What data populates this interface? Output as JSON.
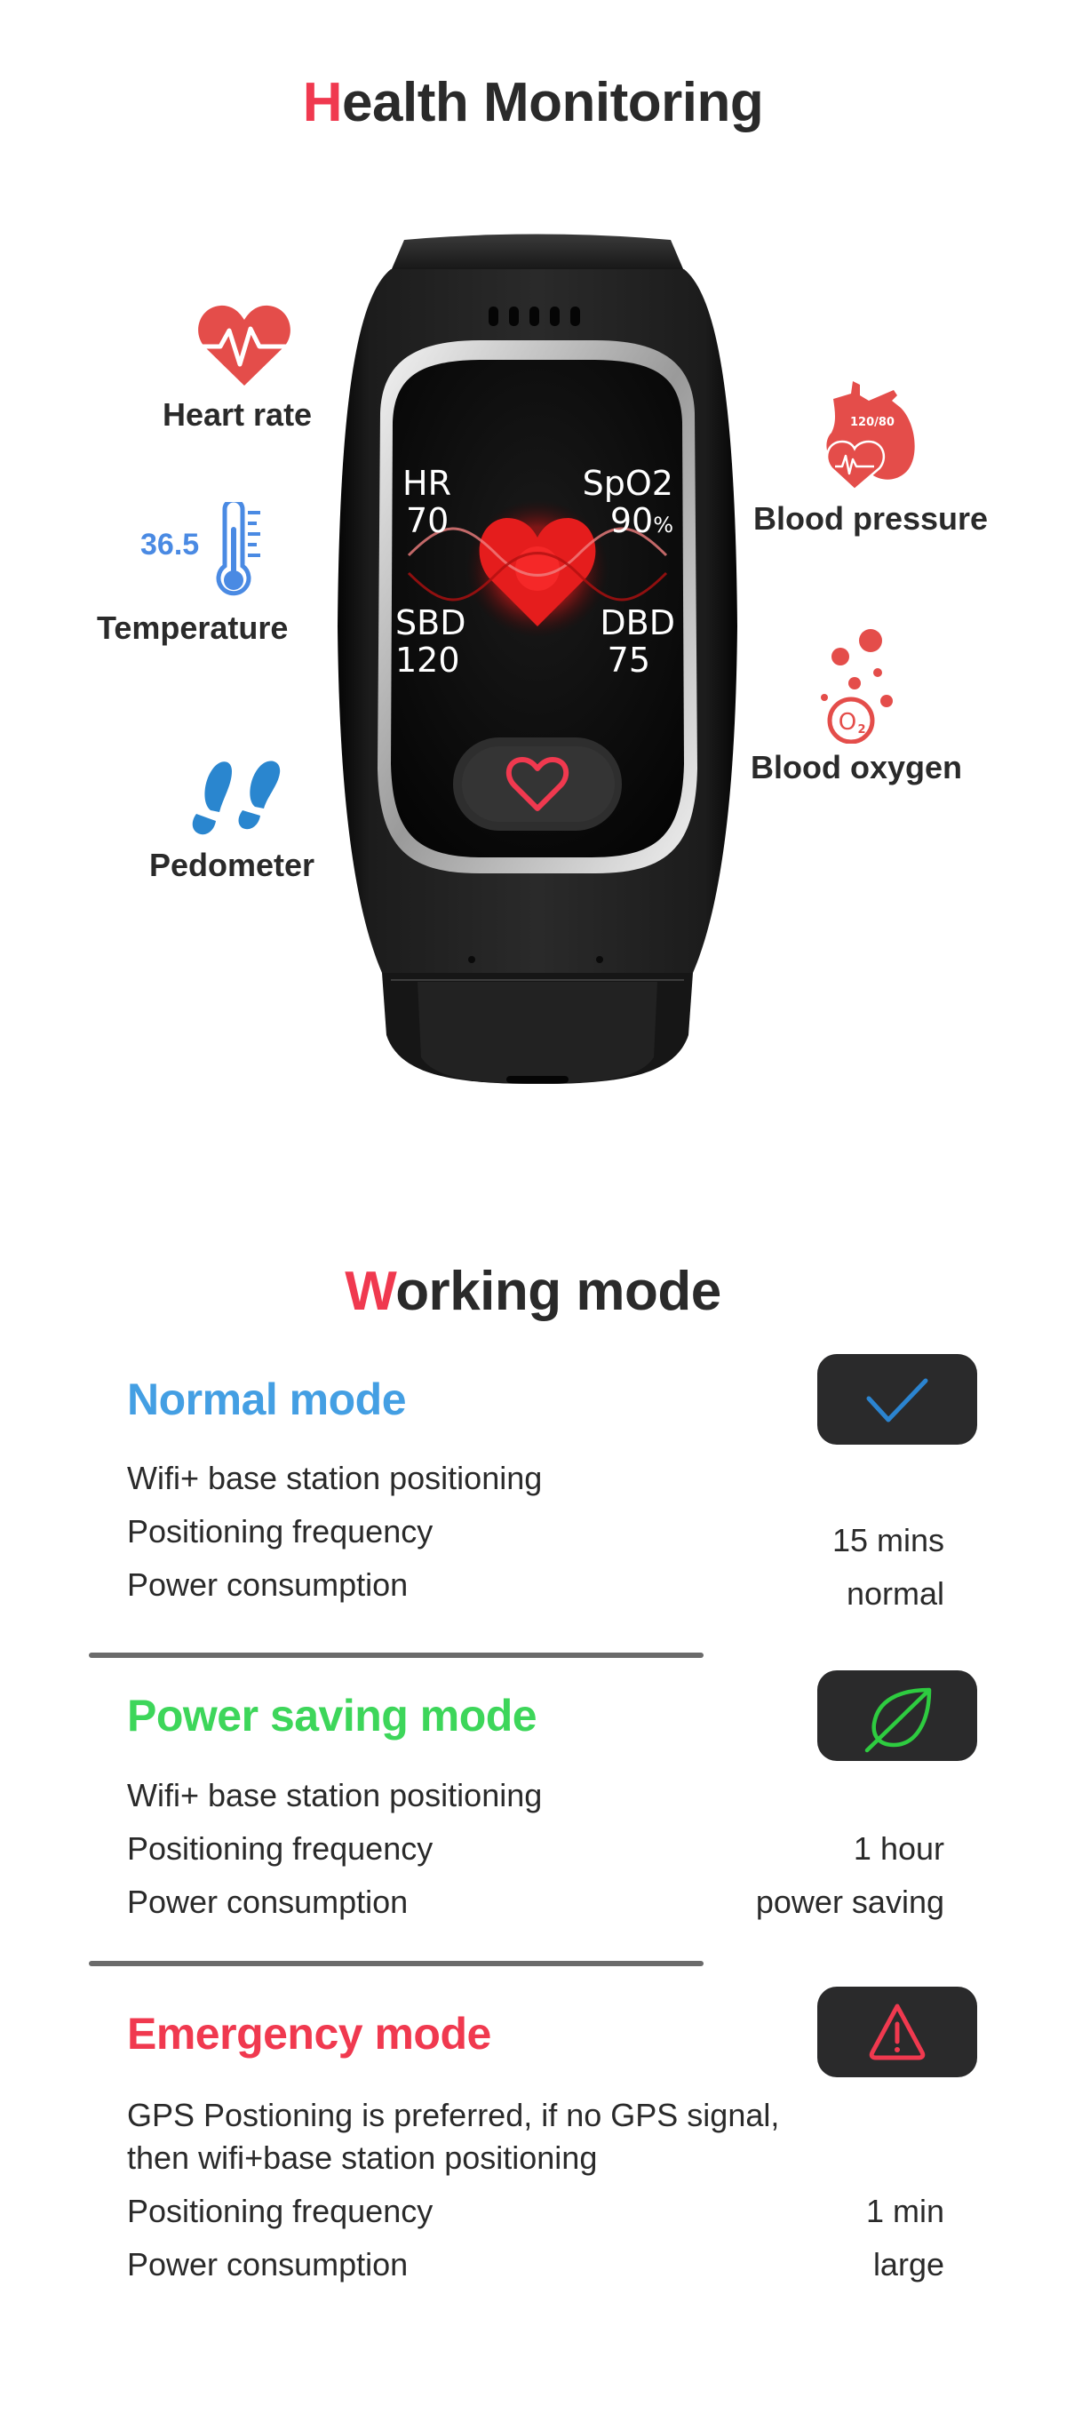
{
  "health": {
    "title_accent": "H",
    "title_rest": "ealth Monitoring",
    "features": [
      {
        "id": "heart-rate",
        "label": "Heart rate",
        "icon": "heart-pulse-icon",
        "color": "#e44d4a"
      },
      {
        "id": "temperature",
        "label": "Temperature",
        "icon": "thermometer-icon",
        "value": "36.5",
        "color": "#4a8ae3"
      },
      {
        "id": "pedometer",
        "label": "Pedometer",
        "icon": "footprints-icon",
        "color": "#2a86cf"
      },
      {
        "id": "blood-pressure",
        "label": "Blood pressure",
        "icon": "heart-organ-icon",
        "icon_text": "120/80",
        "color": "#e44d4a"
      },
      {
        "id": "blood-oxygen",
        "label": "Blood oxygen",
        "icon": "oxygen-bubbles-icon",
        "icon_text": "O",
        "icon_subscript": "2",
        "color": "#e44d4a"
      }
    ],
    "watch_screen": {
      "hr_label": "HR",
      "hr_value": "70",
      "spo2_label": "SpO2",
      "spo2_value": "90",
      "spo2_unit": "%",
      "sbd_label": "SBD",
      "sbd_value": "120",
      "dbd_label": "DBD",
      "dbd_value": "75",
      "button_icon": "heart-outline-icon"
    }
  },
  "working": {
    "title_accent": "W",
    "title_rest": "orking mode",
    "modes": [
      {
        "title": "Normal mode",
        "color": "#449fe3",
        "icon": "checkmark-icon",
        "lines": [
          "Wifi+ base station positioning",
          "Positioning frequency",
          "Power consumption"
        ],
        "frequency": "15 mins",
        "power": "normal"
      },
      {
        "title": "Power saving mode",
        "color": "#3dd65a",
        "icon": "leaf-icon",
        "lines": [
          "Wifi+ base station positioning",
          "Positioning frequency",
          "Power consumption"
        ],
        "frequency": "1 hour",
        "power": "power saving"
      },
      {
        "title": "Emergency mode",
        "color": "#f0394f",
        "icon": "warning-triangle-icon",
        "lines": [
          "GPS Postioning is preferred, if no GPS signal,",
          "then wifi+base station positioning",
          "Positioning frequency",
          "Power consumption"
        ],
        "frequency": "1 min",
        "power": "large"
      }
    ]
  },
  "colors": {
    "accent_red": "#f0394f",
    "text_dark": "#2a2a2a",
    "icon_box": "#2a2a2b",
    "divider": "#6b6b6b"
  }
}
